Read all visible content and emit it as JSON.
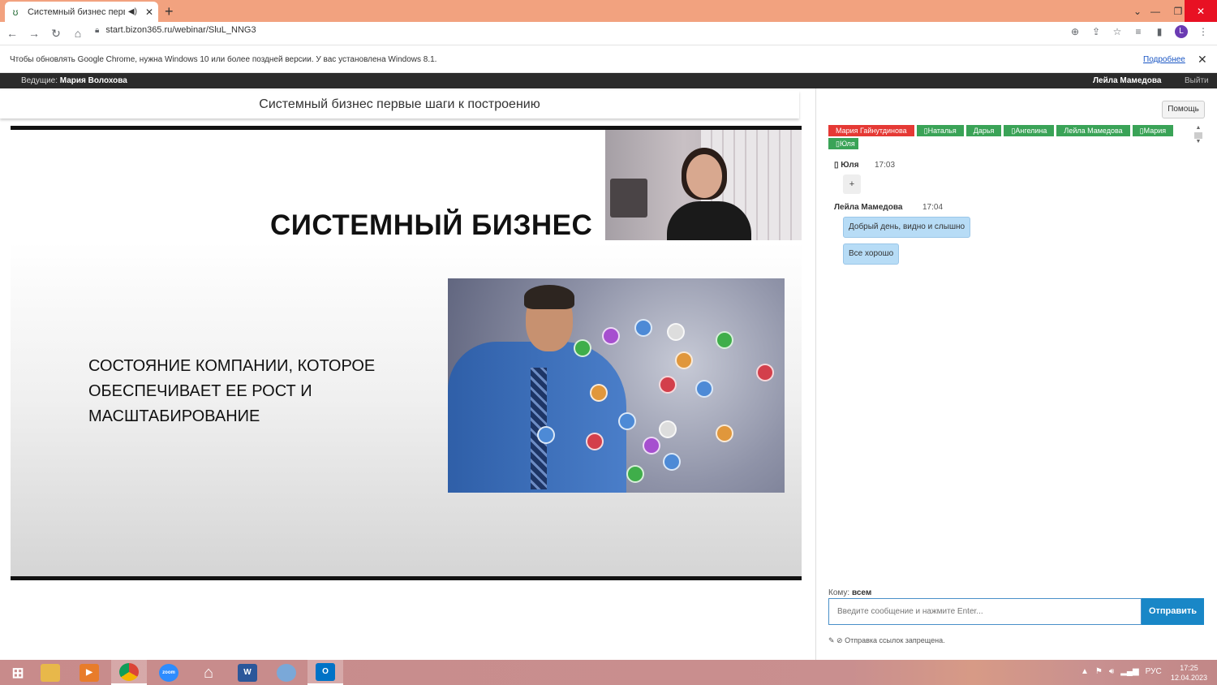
{
  "browser": {
    "tab_title": "Системный бизнес первые",
    "url": "start.bizon365.ru/webinar/SluL_NNG3",
    "profile_initial": "L",
    "infobar_text": "Чтобы обновлять Google Chrome, нужна Windows 10 или более поздней версии. У вас установлена Windows 8.1.",
    "infobar_link": "Подробнее"
  },
  "webinar": {
    "host_label": "Ведущие:",
    "host_name": "Мария Волохова",
    "user_name": "Лейла Мамедова",
    "logout": "Выйти",
    "title": "Системный бизнес первые шаги к построению"
  },
  "slide": {
    "heading": "СИСТЕМНЫЙ БИЗНЕС",
    "text": "СОСТОЯНИЕ КОМПАНИИ, КОТОРОЕ ОБЕСПЕЧИВАЕТ ЕЕ РОСТ И МАСШТАБИРОВАНИЕ"
  },
  "chat": {
    "help": "Помощь",
    "participants": [
      {
        "name": "Мария Гайнутдинова",
        "color": "#e53935"
      },
      {
        "name": "▯Наталья",
        "color": "#3aa357"
      },
      {
        "name": "Дарья",
        "color": "#3aa357"
      },
      {
        "name": "▯Ангелина",
        "color": "#3aa357"
      },
      {
        "name": "Лейла Мамедова",
        "color": "#3aa357"
      },
      {
        "name": "▯Мария",
        "color": "#3aa357"
      },
      {
        "name": "▯Юля",
        "color": "#3aa357"
      }
    ],
    "messages": [
      {
        "author": "▯ Юля",
        "time": "17:03",
        "text": "+"
      },
      {
        "author": "Лейла Мамедова",
        "time": "17:04",
        "texts": [
          "Добрый день, видно и слышно",
          "Все хорошо"
        ]
      }
    ],
    "to_label": "Кому:",
    "to_value": "всем",
    "input_placeholder": "Введите сообщение и нажмите Enter...",
    "send": "Отправить",
    "links_note": "Отправка ссылок запрещена."
  },
  "taskbar": {
    "lang": "РУС",
    "time": "17:25",
    "date": "12.04.2023"
  }
}
